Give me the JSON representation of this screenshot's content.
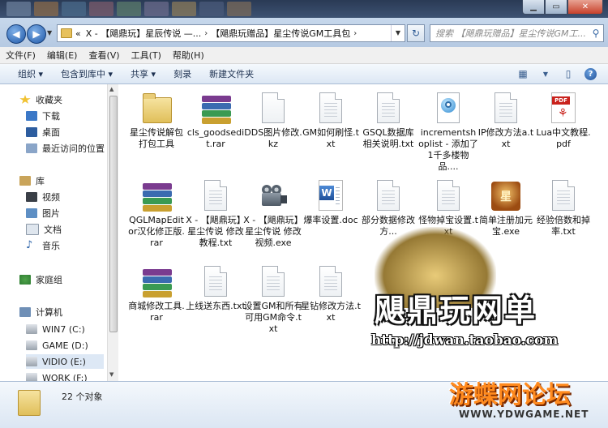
{
  "address": {
    "nav_prefix": "«",
    "crumb1": "X - 【飓鼎玩】星辰传说 —...",
    "crumb2": "【飓鼎玩赠品】星尘传说GM工具包",
    "sep": "›"
  },
  "search": {
    "placeholder": "搜索 【飓鼎玩赠品】星尘传说GM工..."
  },
  "menu": [
    "文件(F)",
    "编辑(E)",
    "查看(V)",
    "工具(T)",
    "帮助(H)"
  ],
  "toolbar": [
    "组织 ▾",
    "包含到库中 ▾",
    "共享 ▾",
    "刻录",
    "新建文件夹"
  ],
  "nav": {
    "favorites": "收藏夹",
    "downloads": "下载",
    "desktop": "桌面",
    "recent": "最近访问的位置",
    "libraries": "库",
    "videos": "视频",
    "pictures": "图片",
    "documents": "文档",
    "music": "音乐",
    "homegroup": "家庭组",
    "computer": "计算机",
    "drive_c": "WIN7 (C:)",
    "drive_d": "GAME (D:)",
    "drive_e": "VIDIO (E:)",
    "drive_f": "WORK (F:)"
  },
  "files": [
    {
      "name": "星尘传说解包打包工具",
      "icon": "folder"
    },
    {
      "name": "cls_goodsedit.rar",
      "icon": "rar"
    },
    {
      "name": "DDS图片修改.kz",
      "icon": "doc"
    },
    {
      "name": "GM如何刷怪.txt",
      "icon": "doc"
    },
    {
      "name": "GSQL数据库相关说明.txt",
      "icon": "doc"
    },
    {
      "name": "incrementshoplist - 添加了1千多楼物品....",
      "icon": "web"
    },
    {
      "name": "IP修改方法a.txt",
      "icon": "doc"
    },
    {
      "name": "Lua中文教程.pdf",
      "icon": "pdf"
    },
    {
      "name": "QGLMapEditor汉化修正版.rar",
      "icon": "rar"
    },
    {
      "name": "X - 【飓鼎玩】星尘传说 修改教程.txt",
      "icon": "doc"
    },
    {
      "name": "X - 【飓鼎玩】星尘传说 修改视频.exe",
      "icon": "camera"
    },
    {
      "name": "爆率设置.doc",
      "icon": "word"
    },
    {
      "name": "部分数据修改方...",
      "icon": "doc"
    },
    {
      "name": "怪物掉宝设置.txt",
      "icon": "doc"
    },
    {
      "name": "简单注册加元宝.exe",
      "icon": "game"
    },
    {
      "name": "经验倍数和掉率.txt",
      "icon": "doc"
    },
    {
      "name": "商城修改工具.rar",
      "icon": "rar"
    },
    {
      "name": "上线送东西.txt",
      "icon": "doc"
    },
    {
      "name": "设置GM和所有可用GM命令.txt",
      "icon": "doc"
    },
    {
      "name": "星钻修改方法.txt",
      "icon": "doc"
    }
  ],
  "status": {
    "count": "22 个对象"
  },
  "watermark": {
    "title": "飓鼎玩网单",
    "url": "http://jdwan.taobao.com",
    "forum": "游蝶网论坛",
    "forum_url": "WWW.YDWGAME.NET"
  }
}
